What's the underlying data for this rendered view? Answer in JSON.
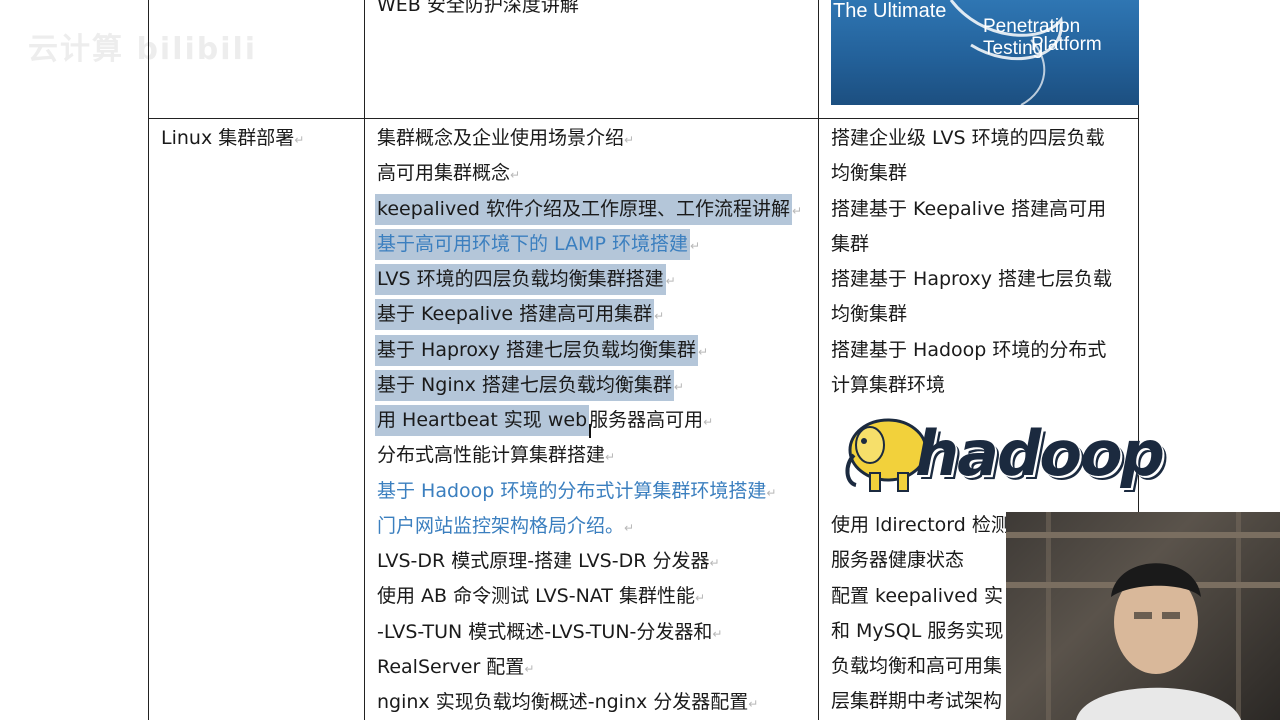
{
  "watermark": "云计算 bilibili",
  "top_row": {
    "course_fragment": "WEB 安全防护深度讲解",
    "kali_line1": "The Ultimate",
    "kali_line2": "Penetration Testing",
    "kali_line3": "Platform"
  },
  "row": {
    "category": "Linux 集群部署",
    "topics": [
      {
        "text": "集群概念及企业使用场景介绍",
        "highlight": false,
        "blue": false
      },
      {
        "text": "高可用集群概念",
        "highlight": false,
        "blue": false
      },
      {
        "text": "keepalived 软件介绍及工作原理、工作流程讲解",
        "highlight": true,
        "blue": false
      },
      {
        "text": "基于高可用环境下的 LAMP 环境搭建",
        "highlight": true,
        "blue": true
      },
      {
        "text": "LVS 环境的四层负载均衡集群搭建",
        "highlight": true,
        "blue": false
      },
      {
        "text": "基于 Keepalive 搭建高可用集群",
        "highlight": true,
        "blue": false
      },
      {
        "text": "基于 Haproxy 搭建七层负载均衡集群",
        "highlight": true,
        "blue": false
      },
      {
        "text": "基于 Nginx 搭建七层负载均衡集群",
        "highlight": true,
        "blue": false
      },
      {
        "text": "用 Heartbeat 实现 web 服务器高可用",
        "highlight": "partial",
        "blue": false,
        "hl_part": "用 Heartbeat 实现 web",
        "rest": "服务器高可用"
      },
      {
        "text": "分布式高性能计算集群搭建",
        "highlight": false,
        "blue": false
      },
      {
        "text": "基于 Hadoop 环境的分布式计算集群环境搭建",
        "highlight": false,
        "blue": true
      },
      {
        "text": "门户网站监控架构格局介绍。",
        "highlight": false,
        "blue": true
      },
      {
        "text": "LVS-DR 模式原理-搭建 LVS-DR 分发器",
        "highlight": false,
        "blue": false
      },
      {
        "text": "使用 AB 命令测试 LVS-NAT 集群性能",
        "highlight": false,
        "blue": false
      },
      {
        "text": "-LVS-TUN 模式概述-LVS-TUN-分发器和",
        "highlight": false,
        "blue": false
      },
      {
        "text": "RealServer 配置",
        "highlight": false,
        "blue": false
      },
      {
        "text": "nginx 实现负载均衡概述-nginx 分发器配置",
        "highlight": false,
        "blue": false
      }
    ],
    "projects": [
      "搭建企业级 LVS 环境的四层负载",
      "均衡集群",
      "搭建基于 Keepalive 搭建高可用",
      "集群",
      "搭建基于 Haproxy 搭建七层负载",
      "均衡集群",
      "搭建基于 Hadoop 环境的分布式",
      "计算集群环境"
    ],
    "projects_lower": [
      "使用 ldirectord 检测",
      "服务器健康状态",
      "配置 keepalived 实",
      "和 MySQL 服务实现",
      "负载均衡和高可用集",
      "层集群期中考试架构"
    ],
    "hadoop_logo_text": "hadoop"
  },
  "colors": {
    "highlight": "#b4c6d9",
    "link_blue": "#3b7fbf",
    "kali_blue": "#2f76b3"
  }
}
